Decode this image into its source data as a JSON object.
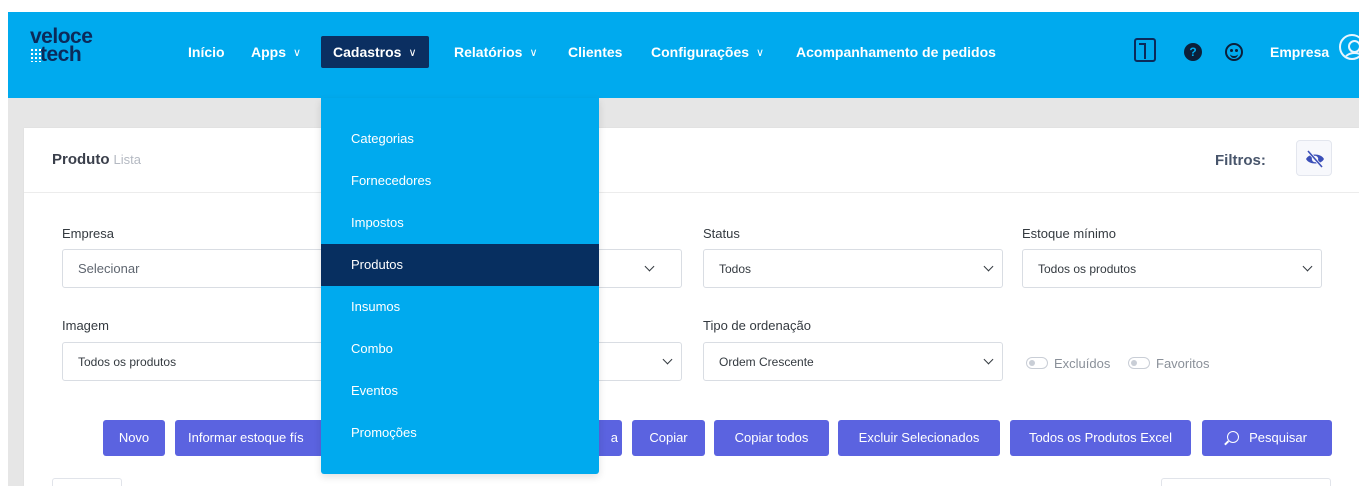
{
  "brand": {
    "line1": "veloce",
    "line2": "tech"
  },
  "nav": {
    "items": [
      {
        "label": "Início",
        "has_menu": false
      },
      {
        "label": "Apps",
        "has_menu": true
      },
      {
        "label": "Cadastros",
        "has_menu": true,
        "active": true
      },
      {
        "label": "Relatórios",
        "has_menu": true
      },
      {
        "label": "Clientes",
        "has_menu": false
      },
      {
        "label": "Configurações",
        "has_menu": true
      },
      {
        "label": "Acompanhamento de pedidos",
        "has_menu": false
      }
    ],
    "chevron": "∨",
    "help_glyph": "?",
    "account_label": "Empresa"
  },
  "dropdown": {
    "items": [
      "Categorias",
      "Fornecedores",
      "Impostos",
      "Produtos",
      "Insumos",
      "Combo",
      "Eventos",
      "Promoções"
    ],
    "active": "Produtos"
  },
  "header": {
    "title": "Produto",
    "subtitle": "Lista",
    "filters_label": "Filtros:"
  },
  "filters": {
    "empresa": {
      "label": "Empresa",
      "placeholder": "Selecionar"
    },
    "status": {
      "label": "Status",
      "value": "Todos"
    },
    "estoque_minimo": {
      "label": "Estoque mínimo",
      "value": "Todos os produtos"
    },
    "imagem": {
      "label": "Imagem",
      "value": "Todos os produtos"
    },
    "tipo_ordenacao": {
      "label": "Tipo de ordenação",
      "value": "Ordem Crescente"
    },
    "excluidos_label": "Excluídos",
    "favoritos_label": "Favoritos"
  },
  "actions": {
    "novo": "Novo",
    "informar_estoque": "Informar estoque fís",
    "hidden_partial": "a",
    "copiar": "Copiar",
    "copiar_todos": "Copiar todos",
    "excluir_selecionados": "Excluir Selecionados",
    "todos_excel": "Todos os Produtos Excel",
    "pesquisar": "Pesquisar"
  },
  "colors": {
    "nav_bg": "#00aaee",
    "nav_active": "#0b2f61",
    "button": "#5b63e0",
    "text_dark": "#343a40"
  }
}
